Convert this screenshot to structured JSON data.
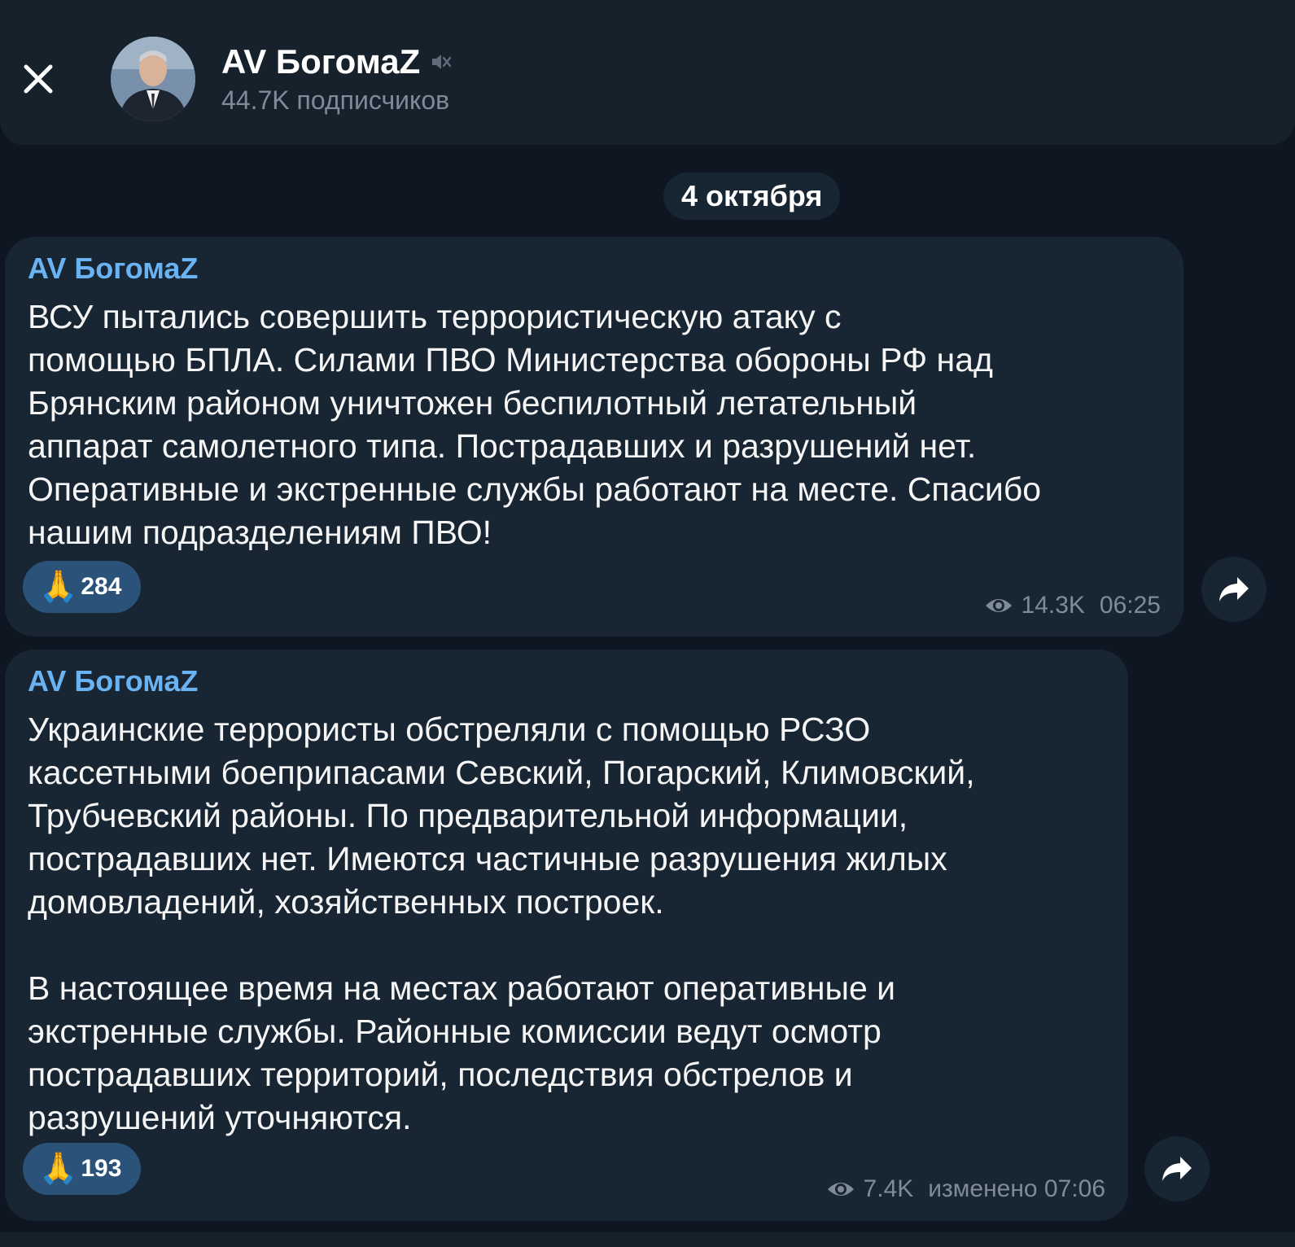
{
  "channel": {
    "name": "AV БогомаZ",
    "subscribers": "44.7K подписчиков"
  },
  "date_separator": "4 октября",
  "messages": [
    {
      "author": "AV БогомаZ",
      "text": "ВСУ пытались совершить террористическую атаку  с\nпомощью БПЛА. Силами ПВО Министерства обороны РФ над\nБрянским районом уничтожен беспилотный летательный\nаппарат самолетного типа. Пострадавших и разрушений нет.\nОперативные и экстренные службы работают на месте. Спасибо\nнашим подразделениям ПВО!",
      "reaction": {
        "emoji": "🙏",
        "count": "284"
      },
      "views": "14.3K",
      "time": "06:25"
    },
    {
      "author": "AV БогомаZ",
      "text": "Украинские террористы обстреляли с помощью РСЗО\nкассетными боеприпасами Севский, Погарский, Климовский,\nТрубчевский районы. По предварительной информации,\nпострадавших нет. Имеются частичные разрушения жилых\nдомовладений, хозяйственных построек.\n\nВ настоящее время на местах работают оперативные и\nэкстренные службы. Районные комиссии ведут  осмотр\nпострадавших территорий, последствия обстрелов и\nразрушений уточняются.",
      "reaction": {
        "emoji": "🙏",
        "count": "193"
      },
      "views": "7.4K",
      "time": "изменено 07:06"
    }
  ],
  "colors": {
    "background": "#0e1621",
    "header": "#17212b",
    "bubble": "#182533",
    "author": "#6ab3f3",
    "meta": "#7f8b98",
    "reaction": "#2b5278"
  }
}
